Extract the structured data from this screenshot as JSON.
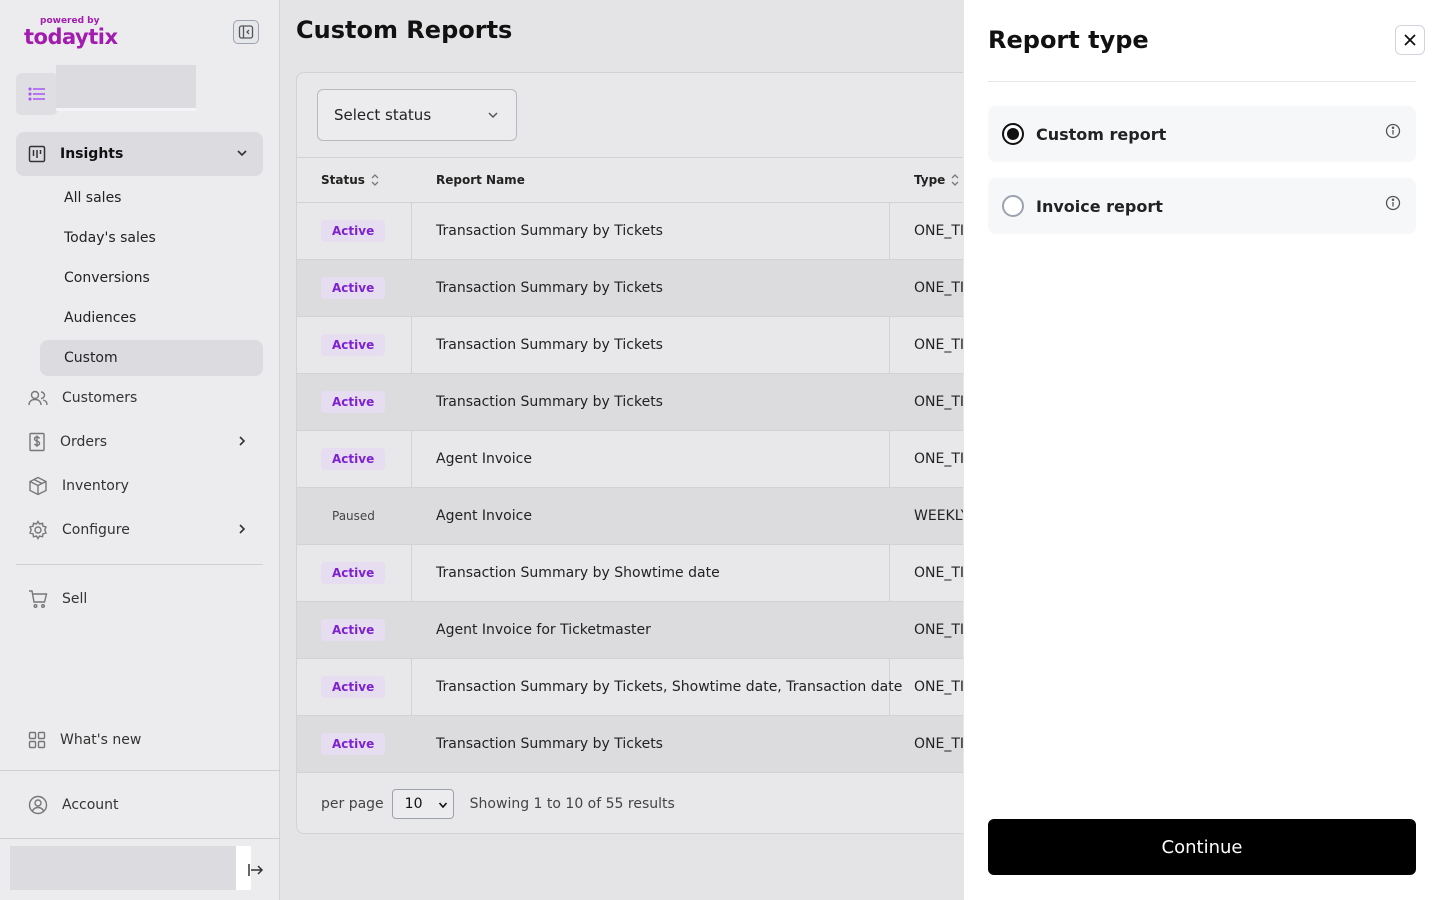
{
  "sidebar": {
    "logo": {
      "powered_by": "powered by",
      "brand": "todaytix"
    },
    "insights": {
      "label": "Insights",
      "items": [
        {
          "label": "All sales"
        },
        {
          "label": "Today's sales"
        },
        {
          "label": "Conversions"
        },
        {
          "label": "Audiences"
        },
        {
          "label": "Custom"
        }
      ]
    },
    "nav": [
      {
        "label": "Customers"
      },
      {
        "label": "Orders"
      },
      {
        "label": "Inventory"
      },
      {
        "label": "Configure"
      },
      {
        "label": "Sell"
      },
      {
        "label": "What's new"
      },
      {
        "label": "Account"
      }
    ]
  },
  "main": {
    "title": "Custom Reports",
    "status_select": "Select status",
    "table": {
      "headers": {
        "status": "Status",
        "name": "Report Name",
        "type": "Type"
      },
      "rows": [
        {
          "status": "Active",
          "name": "Transaction Summary by Tickets",
          "type": "ONE_TI"
        },
        {
          "status": "Active",
          "name": "Transaction Summary by Tickets",
          "type": "ONE_TI"
        },
        {
          "status": "Active",
          "name": "Transaction Summary by Tickets",
          "type": "ONE_TI"
        },
        {
          "status": "Active",
          "name": "Transaction Summary by Tickets",
          "type": "ONE_TI"
        },
        {
          "status": "Active",
          "name": "Agent Invoice",
          "type": "ONE_TI"
        },
        {
          "status": "Paused",
          "name": "Agent Invoice",
          "type": "WEEKLY"
        },
        {
          "status": "Active",
          "name": "Transaction Summary by Showtime date",
          "type": "ONE_TI"
        },
        {
          "status": "Active",
          "name": "Agent Invoice for Ticketmaster",
          "type": "ONE_TI"
        },
        {
          "status": "Active",
          "name": "Transaction Summary by Tickets, Showtime date, Transaction date",
          "type": "ONE_TI"
        },
        {
          "status": "Active",
          "name": "Transaction Summary by Tickets",
          "type": "ONE_TI"
        }
      ]
    },
    "footer": {
      "per_page_label": "per page",
      "per_page_value": "10",
      "showing": "Showing 1 to 10 of 55 results"
    }
  },
  "drawer": {
    "title": "Report type",
    "options": [
      {
        "label": "Custom report",
        "checked": true
      },
      {
        "label": "Invoice report",
        "checked": false
      }
    ],
    "continue_label": "Continue"
  },
  "colors": {
    "brand": "#a21caf",
    "active_badge_bg": "#e6ddf0",
    "active_badge_text": "#7e22ce",
    "primary_button": "#000000"
  }
}
